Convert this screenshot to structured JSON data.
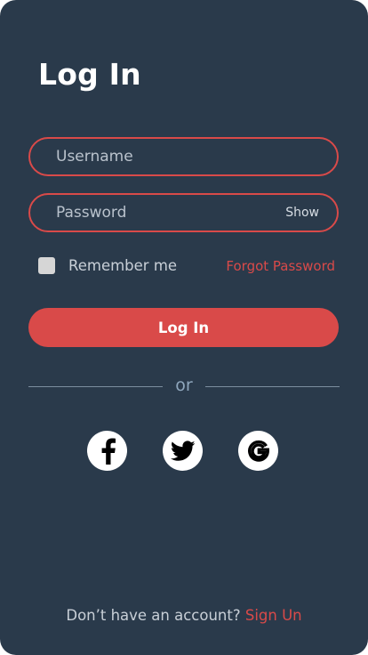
{
  "header": {
    "title": "Log In"
  },
  "form": {
    "username": {
      "placeholder": "Username",
      "value": ""
    },
    "password": {
      "placeholder": "Password",
      "value": "",
      "toggle_label": "Show"
    },
    "remember_label": "Remember me",
    "remember_checked": false,
    "forgot_label": "Forgot Password",
    "submit_label": "Log In"
  },
  "divider": {
    "label": "or"
  },
  "social": [
    {
      "name": "facebook",
      "icon": "facebook-icon"
    },
    {
      "name": "twitter",
      "icon": "twitter-icon"
    },
    {
      "name": "google",
      "icon": "google-icon"
    }
  ],
  "footer": {
    "prompt": "Don’t have an account? ",
    "signup_label": "Sign Un"
  },
  "colors": {
    "background": "#2a3a4b",
    "accent": "#d94a49",
    "checkbox": "#d6d6d6",
    "divider": "#7b8e9f"
  }
}
